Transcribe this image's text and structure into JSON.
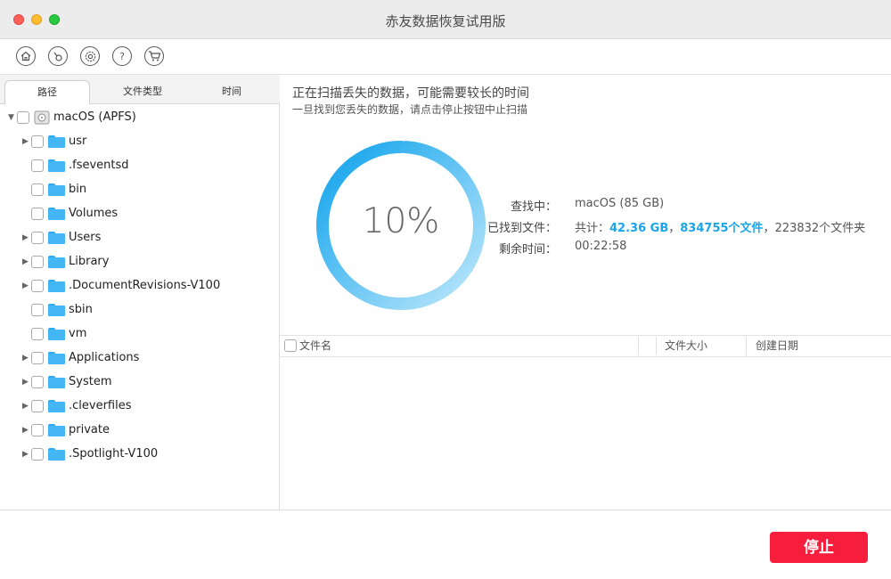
{
  "window": {
    "title": "赤友数据恢复试用版"
  },
  "toolbar": {
    "icons": [
      "home-icon",
      "disk-scan-icon",
      "settings-icon",
      "help-icon",
      "cart-icon"
    ]
  },
  "tabs": {
    "path": "路径",
    "filetype": "文件类型",
    "time": "时间"
  },
  "tree": {
    "root": "macOS (APFS)",
    "items": [
      {
        "label": "usr",
        "expandable": true
      },
      {
        "label": ".fseventsd",
        "expandable": false
      },
      {
        "label": "bin",
        "expandable": false
      },
      {
        "label": "Volumes",
        "expandable": false
      },
      {
        "label": "Users",
        "expandable": true
      },
      {
        "label": "Library",
        "expandable": true
      },
      {
        "label": ".DocumentRevisions-V100",
        "expandable": true
      },
      {
        "label": "sbin",
        "expandable": false
      },
      {
        "label": "vm",
        "expandable": false
      },
      {
        "label": "Applications",
        "expandable": true
      },
      {
        "label": "System",
        "expandable": true
      },
      {
        "label": ".cleverfiles",
        "expandable": true
      },
      {
        "label": "private",
        "expandable": true
      },
      {
        "label": ".Spotlight-V100",
        "expandable": true
      }
    ]
  },
  "scan": {
    "message": "正在扫描丢失的数据，可能需要较长的时间",
    "hint": "一旦找到您丢失的数据，请点击停止按钮中止扫描",
    "progress_label": "10%",
    "progress_fraction": 0.1,
    "searching_label": "查找中：",
    "searching_value": "macOS (85 GB)",
    "found_label": "已找到文件：",
    "found_prefix": "共计：",
    "found_size": "42.36 GB",
    "found_sep1": "，",
    "found_files": "834755个文件",
    "found_sep2": "，",
    "found_folders": "223832个文件夹",
    "remaining_label": "剩余时间：",
    "remaining_value": "00:22:58"
  },
  "filetable": {
    "col_name": "文件名",
    "col_size": "文件大小",
    "col_date": "创建日期"
  },
  "footer": {
    "stop_label": "停止"
  },
  "colors": {
    "accent": "#1ba5e8",
    "stop": "#f71e3d",
    "folder": "#45b6f5"
  }
}
